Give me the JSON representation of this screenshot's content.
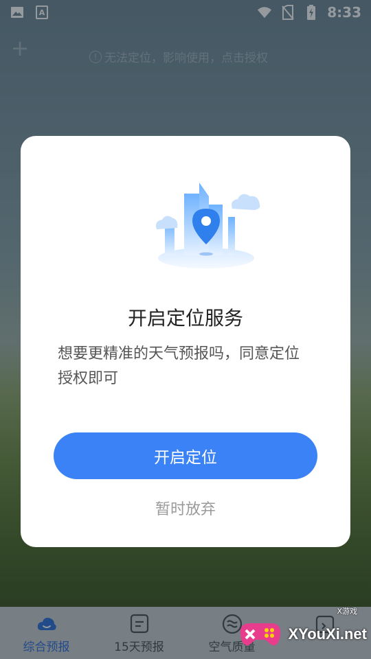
{
  "status_bar": {
    "time": "8:33",
    "left_icons": [
      "image-icon",
      "text-a-icon"
    ],
    "right_icons": [
      "wifi-icon",
      "no-sim-icon",
      "battery-charging-icon"
    ]
  },
  "top_bar": {
    "add_icon": "plus-icon",
    "location_warning": "无法定位，影响使用，点击授权",
    "warning_icon": "info-icon"
  },
  "dialog": {
    "title": "开启定位服务",
    "message": "想要更精准的天气预报吗，同意定位授权即可",
    "primary_button": "开启定位",
    "secondary_button": "暂时放弃",
    "illustration": "city-location-pin-illustration"
  },
  "bottom_nav": {
    "items": [
      {
        "label": "综合预报",
        "icon": "cloud-icon",
        "active": true
      },
      {
        "label": "15天预报",
        "icon": "list-card-icon",
        "active": false
      },
      {
        "label": "空气质量",
        "icon": "wind-waves-icon",
        "active": false
      },
      {
        "label": "",
        "icon": "calendar-icon",
        "active": false
      }
    ]
  },
  "watermark": {
    "text": "XYouXi.net",
    "small": "X游戏"
  },
  "colors": {
    "accent": "#3a82f6",
    "nav_active": "#2f6fdb",
    "dialog_bg": "#ffffff"
  }
}
